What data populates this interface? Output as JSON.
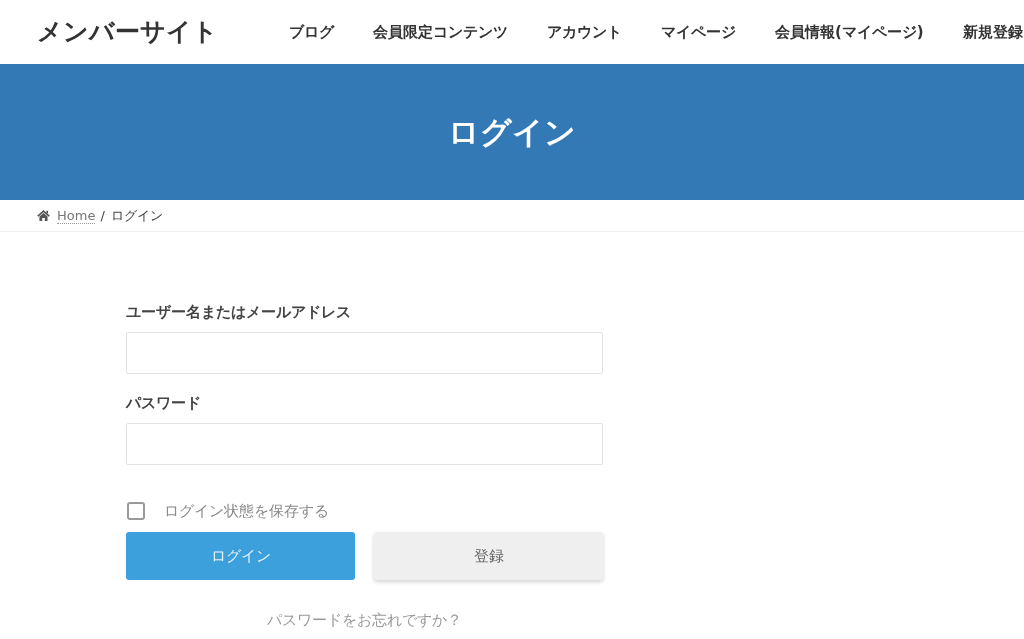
{
  "header": {
    "site_title": "メンバーサイト",
    "nav": [
      "ブログ",
      "会員限定コンテンツ",
      "アカウント",
      "マイページ",
      "会員情報(マイページ)",
      "新規登録"
    ]
  },
  "banner": {
    "title": "ログイン"
  },
  "breadcrumb": {
    "separator": "/",
    "items": [
      {
        "label": "Home",
        "kind": "link"
      },
      {
        "label": "ログイン",
        "kind": "current"
      }
    ]
  },
  "form": {
    "fields": [
      {
        "label": "ユーザー名またはメールアドレス",
        "kind": "text"
      },
      {
        "label": "パスワード",
        "kind": "password"
      }
    ],
    "remember": {
      "label": "ログイン状態を保存する",
      "checked": false
    },
    "buttons": [
      {
        "label": "ログイン",
        "kind": "primary"
      },
      {
        "label": "登録",
        "kind": "secondary"
      }
    ],
    "forgot_link": "パスワードをお忘れですか？"
  }
}
